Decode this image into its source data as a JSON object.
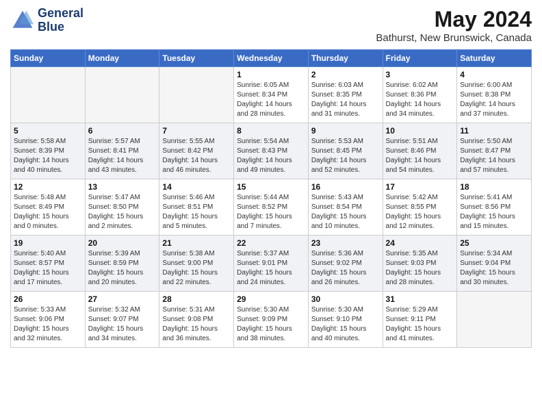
{
  "header": {
    "logo_line1": "General",
    "logo_line2": "Blue",
    "month": "May 2024",
    "location": "Bathurst, New Brunswick, Canada"
  },
  "weekdays": [
    "Sunday",
    "Monday",
    "Tuesday",
    "Wednesday",
    "Thursday",
    "Friday",
    "Saturday"
  ],
  "weeks": [
    [
      {
        "day": "",
        "info": "",
        "empty": true
      },
      {
        "day": "",
        "info": "",
        "empty": true
      },
      {
        "day": "",
        "info": "",
        "empty": true
      },
      {
        "day": "1",
        "info": "Sunrise: 6:05 AM\nSunset: 8:34 PM\nDaylight: 14 hours\nand 28 minutes.",
        "empty": false
      },
      {
        "day": "2",
        "info": "Sunrise: 6:03 AM\nSunset: 8:35 PM\nDaylight: 14 hours\nand 31 minutes.",
        "empty": false
      },
      {
        "day": "3",
        "info": "Sunrise: 6:02 AM\nSunset: 8:36 PM\nDaylight: 14 hours\nand 34 minutes.",
        "empty": false
      },
      {
        "day": "4",
        "info": "Sunrise: 6:00 AM\nSunset: 8:38 PM\nDaylight: 14 hours\nand 37 minutes.",
        "empty": false
      }
    ],
    [
      {
        "day": "5",
        "info": "Sunrise: 5:58 AM\nSunset: 8:39 PM\nDaylight: 14 hours\nand 40 minutes.",
        "empty": false
      },
      {
        "day": "6",
        "info": "Sunrise: 5:57 AM\nSunset: 8:41 PM\nDaylight: 14 hours\nand 43 minutes.",
        "empty": false
      },
      {
        "day": "7",
        "info": "Sunrise: 5:55 AM\nSunset: 8:42 PM\nDaylight: 14 hours\nand 46 minutes.",
        "empty": false
      },
      {
        "day": "8",
        "info": "Sunrise: 5:54 AM\nSunset: 8:43 PM\nDaylight: 14 hours\nand 49 minutes.",
        "empty": false
      },
      {
        "day": "9",
        "info": "Sunrise: 5:53 AM\nSunset: 8:45 PM\nDaylight: 14 hours\nand 52 minutes.",
        "empty": false
      },
      {
        "day": "10",
        "info": "Sunrise: 5:51 AM\nSunset: 8:46 PM\nDaylight: 14 hours\nand 54 minutes.",
        "empty": false
      },
      {
        "day": "11",
        "info": "Sunrise: 5:50 AM\nSunset: 8:47 PM\nDaylight: 14 hours\nand 57 minutes.",
        "empty": false
      }
    ],
    [
      {
        "day": "12",
        "info": "Sunrise: 5:48 AM\nSunset: 8:49 PM\nDaylight: 15 hours\nand 0 minutes.",
        "empty": false
      },
      {
        "day": "13",
        "info": "Sunrise: 5:47 AM\nSunset: 8:50 PM\nDaylight: 15 hours\nand 2 minutes.",
        "empty": false
      },
      {
        "day": "14",
        "info": "Sunrise: 5:46 AM\nSunset: 8:51 PM\nDaylight: 15 hours\nand 5 minutes.",
        "empty": false
      },
      {
        "day": "15",
        "info": "Sunrise: 5:44 AM\nSunset: 8:52 PM\nDaylight: 15 hours\nand 7 minutes.",
        "empty": false
      },
      {
        "day": "16",
        "info": "Sunrise: 5:43 AM\nSunset: 8:54 PM\nDaylight: 15 hours\nand 10 minutes.",
        "empty": false
      },
      {
        "day": "17",
        "info": "Sunrise: 5:42 AM\nSunset: 8:55 PM\nDaylight: 15 hours\nand 12 minutes.",
        "empty": false
      },
      {
        "day": "18",
        "info": "Sunrise: 5:41 AM\nSunset: 8:56 PM\nDaylight: 15 hours\nand 15 minutes.",
        "empty": false
      }
    ],
    [
      {
        "day": "19",
        "info": "Sunrise: 5:40 AM\nSunset: 8:57 PM\nDaylight: 15 hours\nand 17 minutes.",
        "empty": false
      },
      {
        "day": "20",
        "info": "Sunrise: 5:39 AM\nSunset: 8:59 PM\nDaylight: 15 hours\nand 20 minutes.",
        "empty": false
      },
      {
        "day": "21",
        "info": "Sunrise: 5:38 AM\nSunset: 9:00 PM\nDaylight: 15 hours\nand 22 minutes.",
        "empty": false
      },
      {
        "day": "22",
        "info": "Sunrise: 5:37 AM\nSunset: 9:01 PM\nDaylight: 15 hours\nand 24 minutes.",
        "empty": false
      },
      {
        "day": "23",
        "info": "Sunrise: 5:36 AM\nSunset: 9:02 PM\nDaylight: 15 hours\nand 26 minutes.",
        "empty": false
      },
      {
        "day": "24",
        "info": "Sunrise: 5:35 AM\nSunset: 9:03 PM\nDaylight: 15 hours\nand 28 minutes.",
        "empty": false
      },
      {
        "day": "25",
        "info": "Sunrise: 5:34 AM\nSunset: 9:04 PM\nDaylight: 15 hours\nand 30 minutes.",
        "empty": false
      }
    ],
    [
      {
        "day": "26",
        "info": "Sunrise: 5:33 AM\nSunset: 9:06 PM\nDaylight: 15 hours\nand 32 minutes.",
        "empty": false
      },
      {
        "day": "27",
        "info": "Sunrise: 5:32 AM\nSunset: 9:07 PM\nDaylight: 15 hours\nand 34 minutes.",
        "empty": false
      },
      {
        "day": "28",
        "info": "Sunrise: 5:31 AM\nSunset: 9:08 PM\nDaylight: 15 hours\nand 36 minutes.",
        "empty": false
      },
      {
        "day": "29",
        "info": "Sunrise: 5:30 AM\nSunset: 9:09 PM\nDaylight: 15 hours\nand 38 minutes.",
        "empty": false
      },
      {
        "day": "30",
        "info": "Sunrise: 5:30 AM\nSunset: 9:10 PM\nDaylight: 15 hours\nand 40 minutes.",
        "empty": false
      },
      {
        "day": "31",
        "info": "Sunrise: 5:29 AM\nSunset: 9:11 PM\nDaylight: 15 hours\nand 41 minutes.",
        "empty": false
      },
      {
        "day": "",
        "info": "",
        "empty": true
      }
    ]
  ]
}
